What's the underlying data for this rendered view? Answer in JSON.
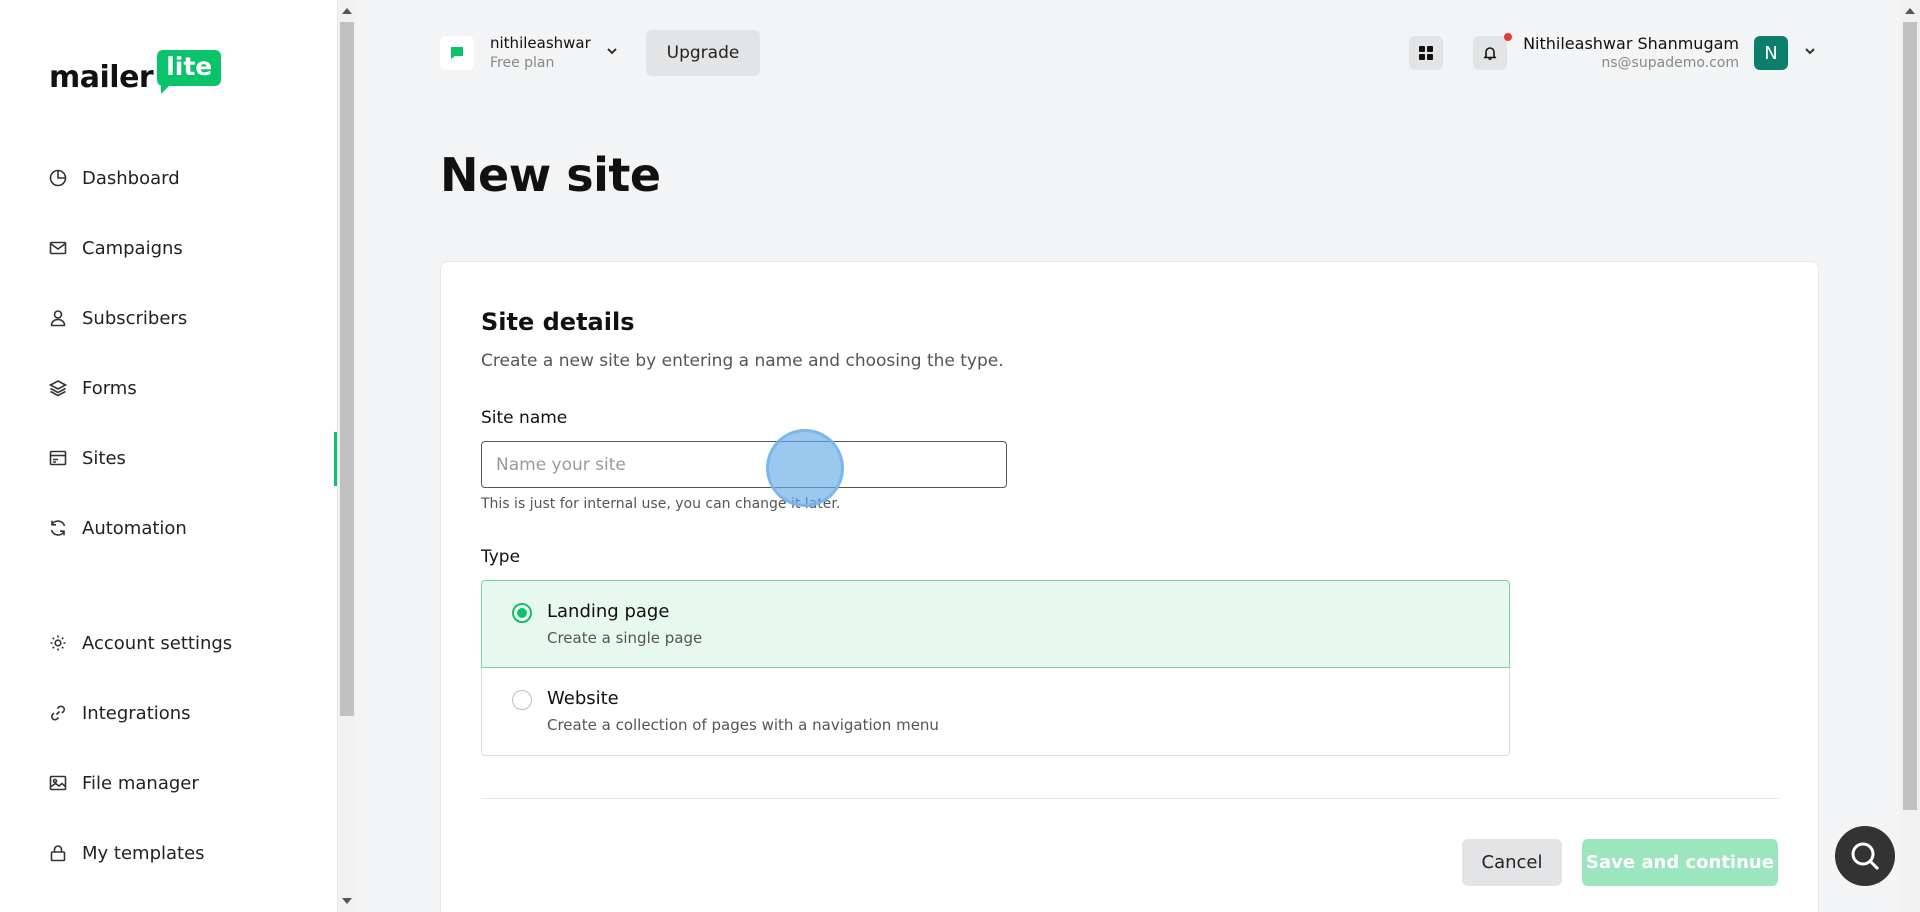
{
  "brand": {
    "logo_text": "mailer",
    "logo_badge": "lite",
    "accent": "#09c269"
  },
  "sidebar": {
    "items": [
      {
        "label": "Dashboard",
        "icon": "dashboard-icon"
      },
      {
        "label": "Campaigns",
        "icon": "mail-icon"
      },
      {
        "label": "Subscribers",
        "icon": "user-icon"
      },
      {
        "label": "Forms",
        "icon": "layers-icon"
      },
      {
        "label": "Sites",
        "icon": "browser-icon",
        "active": true
      },
      {
        "label": "Automation",
        "icon": "refresh-icon"
      },
      {
        "label": "Account settings",
        "icon": "gear-icon"
      },
      {
        "label": "Integrations",
        "icon": "link-icon"
      },
      {
        "label": "File manager",
        "icon": "image-icon"
      },
      {
        "label": "My templates",
        "icon": "lock-icon"
      }
    ]
  },
  "topbar": {
    "account_name": "nithileashwar",
    "account_plan": "Free plan",
    "upgrade_label": "Upgrade",
    "user_name": "Nithileashwar Shanmugam",
    "user_email": "ns@supademo.com",
    "avatar_letter": "N"
  },
  "page": {
    "title": "New site"
  },
  "form": {
    "title": "Site details",
    "subtitle": "Create a new site by entering a name and choosing the type.",
    "site_name_label": "Site name",
    "site_name_value": "",
    "site_name_placeholder": "Name your site",
    "site_name_help": "This is just for internal use, you can change it later.",
    "type_label": "Type",
    "options": [
      {
        "title": "Landing page",
        "desc": "Create a single page",
        "selected": true
      },
      {
        "title": "Website",
        "desc": "Create a collection of pages with a navigation menu",
        "selected": false
      }
    ],
    "cancel_label": "Cancel",
    "save_label": "Save and continue"
  }
}
